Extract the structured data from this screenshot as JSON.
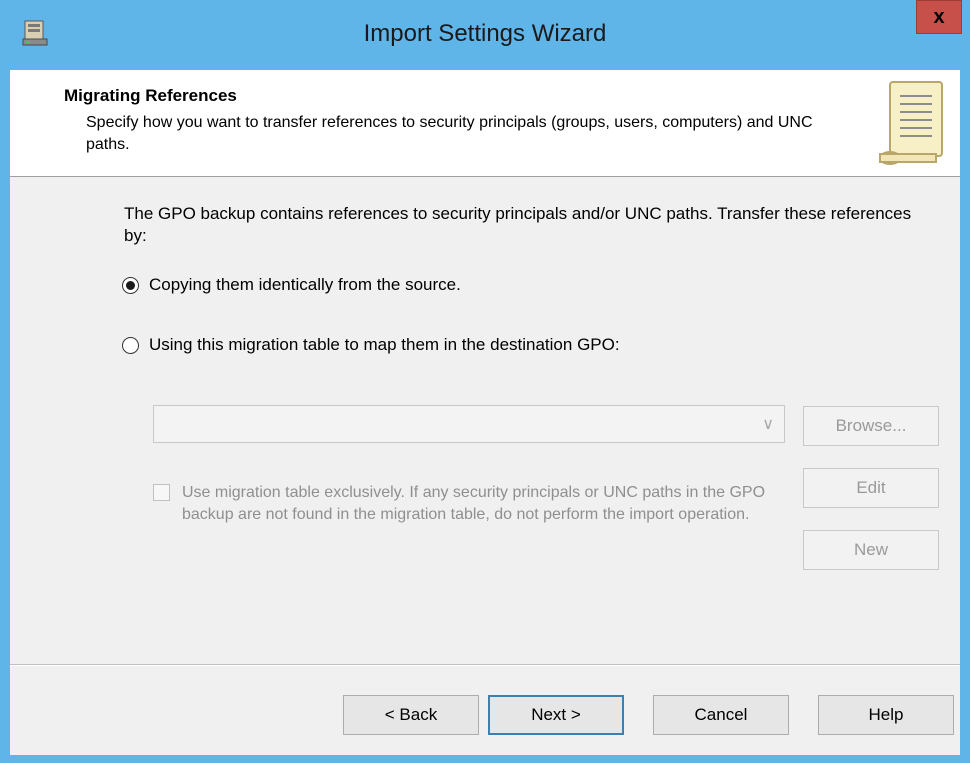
{
  "window": {
    "title": "Import Settings Wizard",
    "close_label": "x",
    "icons": {
      "app": "server-window-icon",
      "close": "close-icon"
    }
  },
  "header": {
    "title": "Migrating References",
    "subtitle": "Specify how you want to transfer references to security principals (groups, users, computers) and UNC paths.",
    "icon": "scroll-document-icon"
  },
  "main": {
    "intro": "The GPO backup contains references to security principals and/or UNC paths.  Transfer these references by:",
    "options": [
      {
        "label": "Copying them identically from the source.",
        "selected": true
      },
      {
        "label": "Using this migration table to map them in the destination GPO:",
        "selected": false
      }
    ],
    "migration_table_value": "",
    "checkbox_label": "Use migration table exclusively.  If any security principals or UNC paths in the GPO backup are not found in the migration table, do not perform the import operation.",
    "checkbox_checked": false,
    "side_buttons": {
      "browse": "Browse...",
      "edit": "Edit",
      "new": "New"
    }
  },
  "footer": {
    "back": "< Back",
    "next": "Next >",
    "cancel": "Cancel",
    "help": "Help"
  },
  "colors": {
    "titlebar": "#5fb4e8",
    "close": "#c7504a",
    "client": "#f0f0f0",
    "default_button_border": "#3c7fb1"
  }
}
